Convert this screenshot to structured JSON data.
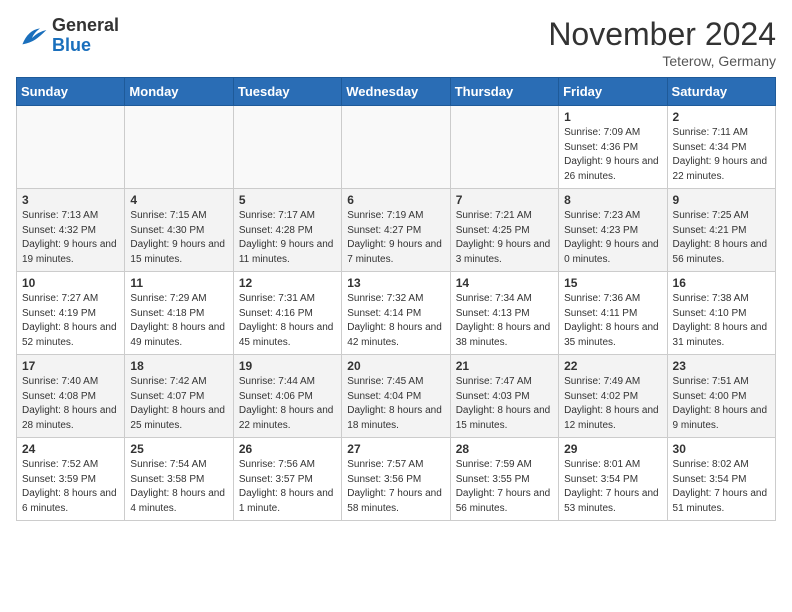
{
  "logo": {
    "general": "General",
    "blue": "Blue"
  },
  "header": {
    "month": "November 2024",
    "location": "Teterow, Germany"
  },
  "days_of_week": [
    "Sunday",
    "Monday",
    "Tuesday",
    "Wednesday",
    "Thursday",
    "Friday",
    "Saturday"
  ],
  "weeks": [
    [
      {
        "day": "",
        "empty": true
      },
      {
        "day": "",
        "empty": true
      },
      {
        "day": "",
        "empty": true
      },
      {
        "day": "",
        "empty": true
      },
      {
        "day": "",
        "empty": true
      },
      {
        "day": "1",
        "sunrise": "Sunrise: 7:09 AM",
        "sunset": "Sunset: 4:36 PM",
        "daylight": "Daylight: 9 hours and 26 minutes."
      },
      {
        "day": "2",
        "sunrise": "Sunrise: 7:11 AM",
        "sunset": "Sunset: 4:34 PM",
        "daylight": "Daylight: 9 hours and 22 minutes."
      }
    ],
    [
      {
        "day": "3",
        "sunrise": "Sunrise: 7:13 AM",
        "sunset": "Sunset: 4:32 PM",
        "daylight": "Daylight: 9 hours and 19 minutes."
      },
      {
        "day": "4",
        "sunrise": "Sunrise: 7:15 AM",
        "sunset": "Sunset: 4:30 PM",
        "daylight": "Daylight: 9 hours and 15 minutes."
      },
      {
        "day": "5",
        "sunrise": "Sunrise: 7:17 AM",
        "sunset": "Sunset: 4:28 PM",
        "daylight": "Daylight: 9 hours and 11 minutes."
      },
      {
        "day": "6",
        "sunrise": "Sunrise: 7:19 AM",
        "sunset": "Sunset: 4:27 PM",
        "daylight": "Daylight: 9 hours and 7 minutes."
      },
      {
        "day": "7",
        "sunrise": "Sunrise: 7:21 AM",
        "sunset": "Sunset: 4:25 PM",
        "daylight": "Daylight: 9 hours and 3 minutes."
      },
      {
        "day": "8",
        "sunrise": "Sunrise: 7:23 AM",
        "sunset": "Sunset: 4:23 PM",
        "daylight": "Daylight: 9 hours and 0 minutes."
      },
      {
        "day": "9",
        "sunrise": "Sunrise: 7:25 AM",
        "sunset": "Sunset: 4:21 PM",
        "daylight": "Daylight: 8 hours and 56 minutes."
      }
    ],
    [
      {
        "day": "10",
        "sunrise": "Sunrise: 7:27 AM",
        "sunset": "Sunset: 4:19 PM",
        "daylight": "Daylight: 8 hours and 52 minutes."
      },
      {
        "day": "11",
        "sunrise": "Sunrise: 7:29 AM",
        "sunset": "Sunset: 4:18 PM",
        "daylight": "Daylight: 8 hours and 49 minutes."
      },
      {
        "day": "12",
        "sunrise": "Sunrise: 7:31 AM",
        "sunset": "Sunset: 4:16 PM",
        "daylight": "Daylight: 8 hours and 45 minutes."
      },
      {
        "day": "13",
        "sunrise": "Sunrise: 7:32 AM",
        "sunset": "Sunset: 4:14 PM",
        "daylight": "Daylight: 8 hours and 42 minutes."
      },
      {
        "day": "14",
        "sunrise": "Sunrise: 7:34 AM",
        "sunset": "Sunset: 4:13 PM",
        "daylight": "Daylight: 8 hours and 38 minutes."
      },
      {
        "day": "15",
        "sunrise": "Sunrise: 7:36 AM",
        "sunset": "Sunset: 4:11 PM",
        "daylight": "Daylight: 8 hours and 35 minutes."
      },
      {
        "day": "16",
        "sunrise": "Sunrise: 7:38 AM",
        "sunset": "Sunset: 4:10 PM",
        "daylight": "Daylight: 8 hours and 31 minutes."
      }
    ],
    [
      {
        "day": "17",
        "sunrise": "Sunrise: 7:40 AM",
        "sunset": "Sunset: 4:08 PM",
        "daylight": "Daylight: 8 hours and 28 minutes."
      },
      {
        "day": "18",
        "sunrise": "Sunrise: 7:42 AM",
        "sunset": "Sunset: 4:07 PM",
        "daylight": "Daylight: 8 hours and 25 minutes."
      },
      {
        "day": "19",
        "sunrise": "Sunrise: 7:44 AM",
        "sunset": "Sunset: 4:06 PM",
        "daylight": "Daylight: 8 hours and 22 minutes."
      },
      {
        "day": "20",
        "sunrise": "Sunrise: 7:45 AM",
        "sunset": "Sunset: 4:04 PM",
        "daylight": "Daylight: 8 hours and 18 minutes."
      },
      {
        "day": "21",
        "sunrise": "Sunrise: 7:47 AM",
        "sunset": "Sunset: 4:03 PM",
        "daylight": "Daylight: 8 hours and 15 minutes."
      },
      {
        "day": "22",
        "sunrise": "Sunrise: 7:49 AM",
        "sunset": "Sunset: 4:02 PM",
        "daylight": "Daylight: 8 hours and 12 minutes."
      },
      {
        "day": "23",
        "sunrise": "Sunrise: 7:51 AM",
        "sunset": "Sunset: 4:00 PM",
        "daylight": "Daylight: 8 hours and 9 minutes."
      }
    ],
    [
      {
        "day": "24",
        "sunrise": "Sunrise: 7:52 AM",
        "sunset": "Sunset: 3:59 PM",
        "daylight": "Daylight: 8 hours and 6 minutes."
      },
      {
        "day": "25",
        "sunrise": "Sunrise: 7:54 AM",
        "sunset": "Sunset: 3:58 PM",
        "daylight": "Daylight: 8 hours and 4 minutes."
      },
      {
        "day": "26",
        "sunrise": "Sunrise: 7:56 AM",
        "sunset": "Sunset: 3:57 PM",
        "daylight": "Daylight: 8 hours and 1 minute."
      },
      {
        "day": "27",
        "sunrise": "Sunrise: 7:57 AM",
        "sunset": "Sunset: 3:56 PM",
        "daylight": "Daylight: 7 hours and 58 minutes."
      },
      {
        "day": "28",
        "sunrise": "Sunrise: 7:59 AM",
        "sunset": "Sunset: 3:55 PM",
        "daylight": "Daylight: 7 hours and 56 minutes."
      },
      {
        "day": "29",
        "sunrise": "Sunrise: 8:01 AM",
        "sunset": "Sunset: 3:54 PM",
        "daylight": "Daylight: 7 hours and 53 minutes."
      },
      {
        "day": "30",
        "sunrise": "Sunrise: 8:02 AM",
        "sunset": "Sunset: 3:54 PM",
        "daylight": "Daylight: 7 hours and 51 minutes."
      }
    ]
  ]
}
